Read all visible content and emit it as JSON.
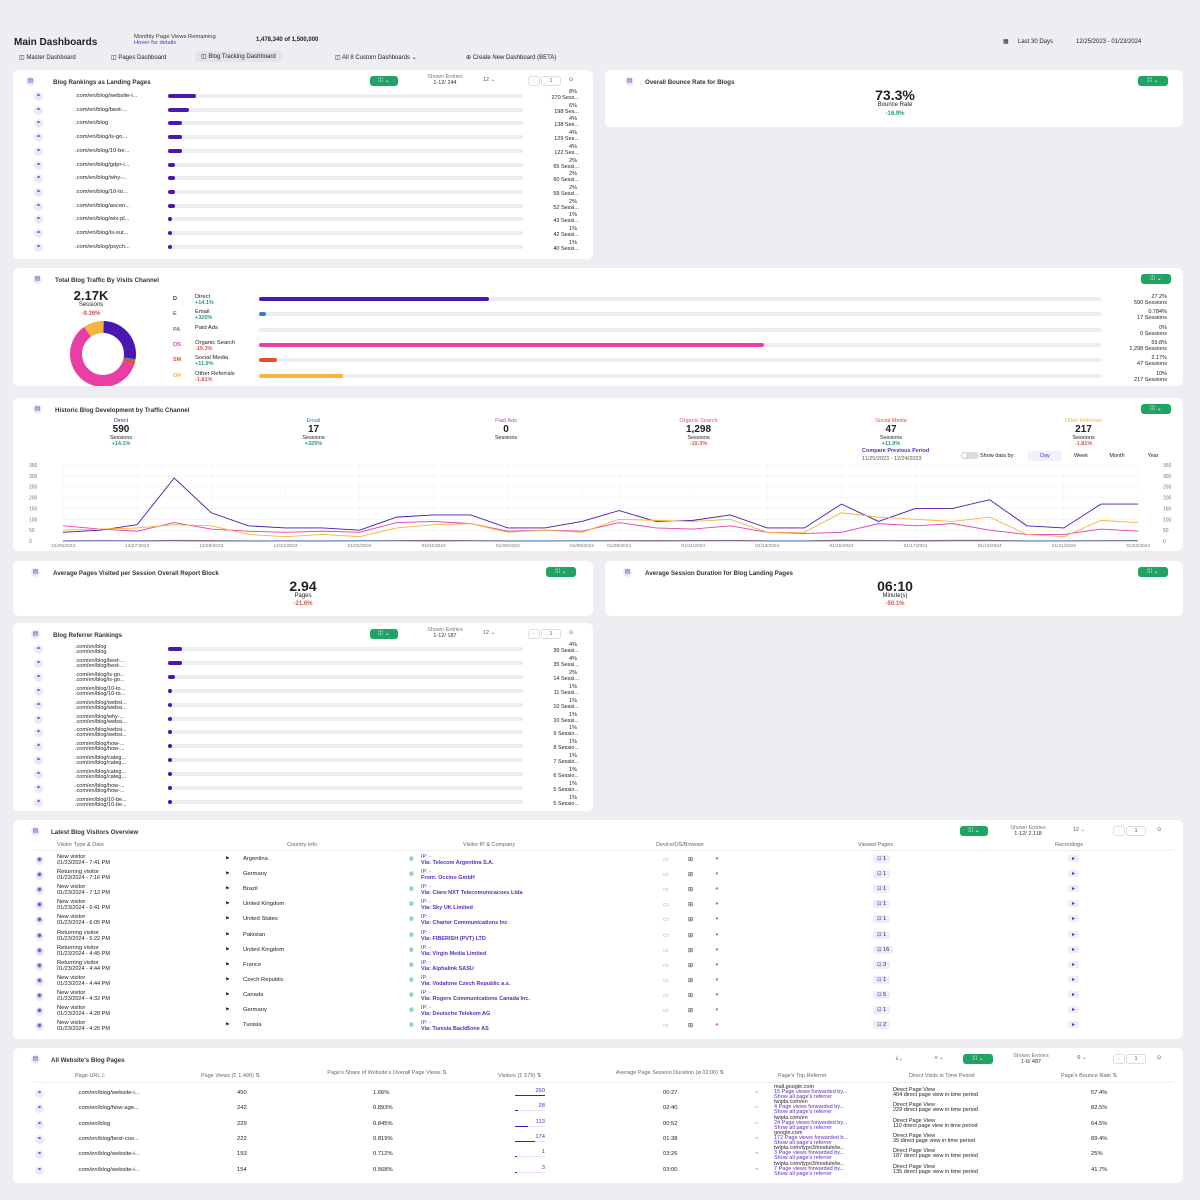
{
  "header": {
    "title": "Main Dashboards",
    "pv_label": "Monthly Page Views Remaining",
    "pv_hover": "Hover for details",
    "pv_value": "1,478,340 of 1,500,000",
    "range_label": "Last 30 Days",
    "range_dates": "12/25/2023 - 01/23/2024"
  },
  "tabs": [
    {
      "label": "Master Dashboard"
    },
    {
      "label": "Pages Dashboard"
    },
    {
      "label": "Blog Tracking Dashboard"
    },
    {
      "label": "All 8 Custom Dashboards"
    },
    {
      "label": "Create New Dashboard (BETA)"
    }
  ],
  "colors": {
    "accent": "#1fa463",
    "primary": "#4a18b0",
    "direct": "#4a18b0",
    "email": "#3a7bd5",
    "organic": "#e83fa6",
    "social": "#e5522a",
    "referral": "#f5b53f"
  },
  "landing": {
    "title": "Blog Rankings as Landing Pages",
    "shown_label": "Shown Entries",
    "shown_value": "1-12/ 244",
    "per_page": "12",
    "page": "1",
    "rows": [
      {
        "url": ".com/en/blog/website-i...",
        "pct": "8%",
        "sessions": "270 Sess...",
        "value": 8
      },
      {
        "url": ".com/en/blog/best-...",
        "pct": "6%",
        "sessions": "198 Ses...",
        "value": 6
      },
      {
        "url": ".com/en/blog",
        "pct": "4%",
        "sessions": "138 Ses...",
        "value": 4
      },
      {
        "url": ".com/en/blog/is-go...",
        "pct": "4%",
        "sessions": "129 Ses...",
        "value": 4
      },
      {
        "url": ".com/en/blog/10-be...",
        "pct": "4%",
        "sessions": "122 Ses...",
        "value": 4
      },
      {
        "url": ".com/en/blog/gdpr-i...",
        "pct": "2%",
        "sessions": "65 Sessi...",
        "value": 2
      },
      {
        "url": ".com/en/blog/why-...",
        "pct": "2%",
        "sessions": "60 Sessi...",
        "value": 2
      },
      {
        "url": ".com/en/blog/10-to...",
        "pct": "2%",
        "sessions": "59 Sessi...",
        "value": 2
      },
      {
        "url": ".com/en/blog/ascen...",
        "pct": "2%",
        "sessions": "52 Sessi...",
        "value": 2
      },
      {
        "url": ".com/en/blog/wix-pl...",
        "pct": "1%",
        "sessions": "43 Sessi...",
        "value": 1
      },
      {
        "url": ".com/en/blog/is-sur...",
        "pct": "1%",
        "sessions": "42 Sessi...",
        "value": 1
      },
      {
        "url": ".com/en/blog/psych...",
        "pct": "1%",
        "sessions": "40 Sessi...",
        "value": 1
      }
    ]
  },
  "bounce": {
    "title": "Overall Bounce Rate for Blogs",
    "value": "73.3%",
    "label": "Bounce Rate",
    "change": "-16.9%"
  },
  "traffic": {
    "title": "Total Blog Traffic By Visits Channel",
    "total": "2.17K",
    "total_label": "Sessions",
    "total_change": "-9.36%",
    "channels": [
      {
        "abbr": "D",
        "name": "Direct",
        "change": "+14.1%",
        "pct": "27.2%",
        "sessions": "590 Sessions",
        "value": 27.2,
        "color": "#4a18b0"
      },
      {
        "abbr": "E",
        "name": "Email",
        "change": "+325%",
        "pct": "0.784%",
        "sessions": "17 Sessions",
        "value": 0.784,
        "color": "#3a7bd5"
      },
      {
        "abbr": "PA",
        "name": "Paid Ads",
        "change": "",
        "pct": "0%",
        "sessions": "0 Sessions",
        "value": 0,
        "color": "#9b59b6"
      },
      {
        "abbr": "OS",
        "name": "Organic Search",
        "change": "-19.3%",
        "pct": "59.8%",
        "sessions": "1,298 Sessions",
        "value": 59.8,
        "color": "#e83fa6"
      },
      {
        "abbr": "SM",
        "name": "Social Media",
        "change": "+11.9%",
        "pct": "2.17%",
        "sessions": "47 Sessions",
        "value": 2.17,
        "color": "#e5522a"
      },
      {
        "abbr": "OR",
        "name": "Other Referrals",
        "change": "-1.81%",
        "pct": "10%",
        "sessions": "217 Sessions",
        "value": 10,
        "color": "#f5b53f"
      }
    ]
  },
  "historic": {
    "title": "Historic Blog Development by Traffic Channel",
    "stats": [
      {
        "name": "Direct",
        "value": "590",
        "label": "Sessions",
        "change": "+14.1%",
        "color": "#4a18b0"
      },
      {
        "name": "Email",
        "value": "17",
        "label": "Sessions",
        "change": "+325%",
        "color": "#3a7bd5"
      },
      {
        "name": "Paid Ads",
        "value": "0",
        "label": "Sessions",
        "change": "",
        "color": "#9b59b6"
      },
      {
        "name": "Organic Search",
        "value": "1,298",
        "label": "Sessions",
        "change": "-19.3%",
        "color": "#e83fa6"
      },
      {
        "name": "Social Media",
        "value": "47",
        "label": "Sessions",
        "change": "+11.9%",
        "color": "#e5522a"
      },
      {
        "name": "Other Referrals",
        "value": "217",
        "label": "Sessions",
        "change": "-1.81%",
        "color": "#f5b53f"
      }
    ],
    "compare_label": "Compare Previous Period",
    "compare_dates": "11/25/2023 - 12/24/2023",
    "show_by": "Show data by:",
    "granularity": [
      "Day",
      "Week",
      "Month",
      "Year"
    ]
  },
  "chart_data": {
    "type": "line",
    "x": [
      "12/25/2023",
      "12/26/2023",
      "12/27/2023",
      "12/28/2023",
      "12/29/2023",
      "12/30/2023",
      "12/31/2023",
      "01/01/2024",
      "01/02/2024",
      "01/03/2024",
      "01/04/2024",
      "01/05/2024",
      "01/06/2024",
      "01/07/2024",
      "01/08/2024",
      "01/09/2024",
      "01/10/2024",
      "01/11/2024",
      "01/12/2024",
      "01/13/2024",
      "01/14/2024",
      "01/15/2024",
      "01/16/2024",
      "01/17/2024",
      "01/18/2024",
      "01/19/2024",
      "01/20/2024",
      "01/21/2024",
      "01/22/2024",
      "01/23/2024"
    ],
    "xticks": [
      "12/25/2023",
      "12/27/2023",
      "12/29/2023",
      "12/31/2023",
      "01/02/2024",
      "01/04/2024",
      "01/06/2024",
      "01/08/2024",
      "01/09/2024",
      "01/11/2024",
      "01/13/2024",
      "01/15/2024",
      "01/17/2024",
      "01/19/2024",
      "01/21/2024",
      "01/23/2024"
    ],
    "yticks": [
      "350",
      "300",
      "250",
      "200",
      "150",
      "100",
      "50",
      "0"
    ],
    "ylim": [
      0,
      350
    ],
    "series": [
      {
        "name": "Organic Search",
        "color": "#e83fa6",
        "values": [
          70,
          55,
          45,
          85,
          55,
          45,
          40,
          45,
          40,
          85,
          90,
          80,
          45,
          50,
          45,
          85,
          60,
          55,
          70,
          40,
          35,
          40,
          80,
          70,
          80,
          50,
          30,
          30,
          55,
          45
        ]
      },
      {
        "name": "Direct",
        "color": "#4a18b0",
        "values": [
          40,
          50,
          75,
          290,
          130,
          70,
          60,
          60,
          50,
          110,
          120,
          120,
          60,
          60,
          90,
          140,
          90,
          95,
          120,
          60,
          60,
          170,
          90,
          150,
          150,
          190,
          70,
          60,
          170,
          170
        ]
      },
      {
        "name": "Other Referrals",
        "color": "#f5b53f",
        "values": [
          50,
          55,
          60,
          75,
          70,
          30,
          20,
          30,
          20,
          60,
          75,
          80,
          40,
          50,
          40,
          100,
          95,
          90,
          100,
          40,
          40,
          130,
          110,
          100,
          90,
          110,
          30,
          20,
          95,
          85
        ]
      },
      {
        "name": "Social Media",
        "color": "#e5522a",
        "values": [
          1,
          2,
          1,
          3,
          2,
          1,
          1,
          1,
          1,
          2,
          3,
          2,
          1,
          1,
          1,
          2,
          2,
          2,
          3,
          1,
          1,
          4,
          2,
          2,
          3,
          3,
          1,
          1,
          2,
          2
        ]
      },
      {
        "name": "Email",
        "color": "#3a7bd5",
        "values": [
          0,
          1,
          0,
          1,
          0,
          0,
          0,
          0,
          1,
          1,
          0,
          1,
          0,
          0,
          1,
          1,
          0,
          1,
          1,
          0,
          0,
          1,
          1,
          0,
          1,
          1,
          0,
          0,
          1,
          1
        ]
      }
    ]
  },
  "pages_visited": {
    "title": "Average Pages Visited per Session Overall Report Block",
    "value": "2.94",
    "label": "Pages",
    "change": "-21.6%"
  },
  "session_duration": {
    "title": "Average Session Duration for Blog Landing Pages",
    "value": "06:10",
    "label": "Minute(s)",
    "change": "-50.1%"
  },
  "referrers": {
    "title": "Blog Referrer Rankings",
    "shown_label": "Shown Entries",
    "shown_value": "1-12/ 187",
    "per_page": "12",
    "page": "1",
    "rows": [
      {
        "url1": ".com/en/blog",
        "url2": ".com/en/blog",
        "pct": "4%",
        "sessions": "39 Sessi...",
        "value": 4
      },
      {
        "url1": ".com/en/blog/best-...",
        "url2": ".com/en/blog/best-...",
        "pct": "4%",
        "sessions": "35 Sessi...",
        "value": 4
      },
      {
        "url1": ".com/en/blog/is-go...",
        "url2": ".com/en/blog/is-go...",
        "pct": "2%",
        "sessions": "14 Sessi...",
        "value": 2
      },
      {
        "url1": ".com/en/blog/10-to...",
        "url2": ".com/en/blog/10-to...",
        "pct": "1%",
        "sessions": "11 Sessi...",
        "value": 1
      },
      {
        "url1": ".com/en/blog/websi...",
        "url2": ".com/en/blog/websi...",
        "pct": "1%",
        "sessions": "10 Sessi...",
        "value": 1
      },
      {
        "url1": ".com/en/blog/why-...",
        "url2": ".com/en/blog/websi...",
        "pct": "1%",
        "sessions": "10 Sessi...",
        "value": 1
      },
      {
        "url1": ".com/en/blog/websi...",
        "url2": ".com/en/blog/websi...",
        "pct": "1%",
        "sessions": "9 Sessio...",
        "value": 1
      },
      {
        "url1": ".com/en/blog/how-...",
        "url2": ".com/en/blog/how-...",
        "pct": "1%",
        "sessions": "8 Sessio...",
        "value": 1
      },
      {
        "url1": ".com/en/blog/categ...",
        "url2": ".com/en/blog/categ...",
        "pct": "1%",
        "sessions": "7 Sessio...",
        "value": 1
      },
      {
        "url1": ".com/en/blog/categ...",
        "url2": ".com/en/blog/categ...",
        "pct": "1%",
        "sessions": "6 Sessio...",
        "value": 1
      },
      {
        "url1": ".com/en/blog/how-...",
        "url2": ".com/en/blog/how-...",
        "pct": "1%",
        "sessions": "5 Sessio...",
        "value": 1
      },
      {
        "url1": ".com/en/blog/10-be...",
        "url2": ".com/en/blog/10-be...",
        "pct": "1%",
        "sessions": "5 Sessio...",
        "value": 1
      }
    ]
  },
  "visitors": {
    "title": "Latest Blog Visitors Overview",
    "shown_label": "Shown Entries",
    "shown_value": "1-12/ 2,118",
    "per_page": "12",
    "page": "1",
    "headers": [
      "Visitor Type & Date",
      "Country Info",
      "Visitor IP & Company",
      "Device/OS/Browser",
      "Viewed Pages",
      "Recordings"
    ],
    "rows": [
      {
        "type": "New visitor",
        "date": "01/23/2024 - 7:41 PM",
        "country": "Argentina",
        "ip": "IP: -",
        "company": "Via: Telecom Argentina S.A.",
        "pages": "1"
      },
      {
        "type": "Returning visitor",
        "date": "01/23/2024 - 7:16 PM",
        "country": "Germany",
        "ip": "IP: -",
        "company": "From: Occino GmbH",
        "pages": "1"
      },
      {
        "type": "New visitor",
        "date": "01/23/2024 - 7:12 PM",
        "country": "Brazil",
        "ip": "IP: -",
        "company": "Via: Claro NXT Telecomunicacoes Ltda",
        "pages": "1"
      },
      {
        "type": "New visitor",
        "date": "01/23/2024 - 6:41 PM",
        "country": "United Kingdom",
        "ip": "IP: -",
        "company": "Via: Sky UK Limited",
        "pages": "1"
      },
      {
        "type": "New visitor",
        "date": "01/23/2024 - 6:05 PM",
        "country": "United States",
        "ip": "IP: -",
        "company": "Via: Charter Communications Inc",
        "pages": "1"
      },
      {
        "type": "Returning visitor",
        "date": "01/23/2024 - 5:22 PM",
        "country": "Pakistan",
        "ip": "IP: -",
        "company": "Via: FIBERISH (PVT) LTD",
        "pages": "1"
      },
      {
        "type": "Returning visitor",
        "date": "01/23/2024 - 4:45 PM",
        "country": "United Kingdom",
        "ip": "IP: -",
        "company": "Via: Virgin Media Limited",
        "pages": "16"
      },
      {
        "type": "Returning visitor",
        "date": "01/23/2024 - 4:44 PM",
        "country": "France",
        "ip": "IP: -",
        "company": "Via: Alphalink SASU",
        "pages": "3"
      },
      {
        "type": "New visitor",
        "date": "01/23/2024 - 4:44 PM",
        "country": "Czech Republic",
        "ip": "IP: -",
        "company": "Via: Vodafone Czech Republic a.s.",
        "pages": "1"
      },
      {
        "type": "New visitor",
        "date": "01/23/2024 - 4:32 PM",
        "country": "Canada",
        "ip": "IP: -",
        "company": "Via: Rogers Communications Canada Inc.",
        "pages": "5"
      },
      {
        "type": "New visitor",
        "date": "01/23/2024 - 4:28 PM",
        "country": "Germany",
        "ip": "IP: -",
        "company": "Via: Deutsche Telekom AG",
        "pages": "1"
      },
      {
        "type": "New visitor",
        "date": "01/23/2024 - 4:26 PM",
        "country": "Tunisia",
        "ip": "IP: -",
        "company": "Via: Tunisia BackBone AS",
        "pages": "2"
      }
    ]
  },
  "blog_pages": {
    "title": "All Website's Blog Pages",
    "shown_label": "Shown Entries",
    "shown_value": "1-6/ 487",
    "per_page": "6",
    "page": "1",
    "headers": [
      "Page URL",
      "Page Views (Σ 1,490)",
      "Page's Share of Website's Overall Page Views",
      "Visitors (Σ 579)",
      "Average Page Session Duration (ø 02:00)",
      "Page's Top Referrer",
      "Direct Visits in Time Period",
      "Page's Bounce Rate"
    ],
    "rows": [
      {
        "url": ".com/en/blog/website-i...",
        "views": "450",
        "share": "1.66%",
        "visitors": "260",
        "duration": "00:27",
        "ref1": "mail.google.com",
        "ref2": "15 Page views forwarded by...",
        "ref3": "Show all page's referrer",
        "direct1": "Direct Page View",
        "direct2": "404 direct page view in time period",
        "bounce": "57.4%"
      },
      {
        "url": ".com/en/blog/how-age...",
        "views": "242",
        "share": "0.893%",
        "visitors": "28",
        "duration": "02:40",
        "ref1": "twipla.com/en",
        "ref2": "4 Page views forwarded by...",
        "ref3": "Show all page's referrer",
        "direct1": "Direct Page View",
        "direct2": "229 direct page view in time period",
        "bounce": "82.5%"
      },
      {
        "url": ".com/en/blog",
        "views": "229",
        "share": "0.845%",
        "visitors": "113",
        "duration": "00:52",
        "ref1": "twipla.com/en",
        "ref2": "24 Page views forwarded by...",
        "ref3": "Show all page's referrer",
        "direct1": "Direct Page View",
        "direct2": "110 direct page view in time period",
        "bounce": "64.5%"
      },
      {
        "url": ".com/en/blog/best-coo...",
        "views": "222",
        "share": "0.819%",
        "visitors": "174",
        "duration": "01:38",
        "ref1": "google.com",
        "ref2": "172 Page views forwarded b...",
        "ref3": "Show all page's referrer",
        "direct1": "Direct Page View",
        "direct2": "35 direct page view in time period",
        "bounce": "89.4%"
      },
      {
        "url": ".com/en/blog/website-i...",
        "views": "193",
        "share": "0.712%",
        "visitors": "1",
        "duration": "03:26",
        "ref1": "twipla.com/typo3/module/w...",
        "ref2": "3 Page views forwarded by...",
        "ref3": "Show all page's referrer",
        "direct1": "Direct Page View",
        "direct2": "187 direct page view in time period",
        "bounce": "25%"
      },
      {
        "url": ".com/en/blog/website-i...",
        "views": "154",
        "share": "0.568%",
        "visitors": "3",
        "duration": "03:00",
        "ref1": "twipla.com/typo3/module/w...",
        "ref2": "7 Page views forwarded by...",
        "ref3": "Show all page's referrer",
        "direct1": "Direct Page View",
        "direct2": "135 direct page view in time period",
        "bounce": "41.7%"
      }
    ]
  }
}
